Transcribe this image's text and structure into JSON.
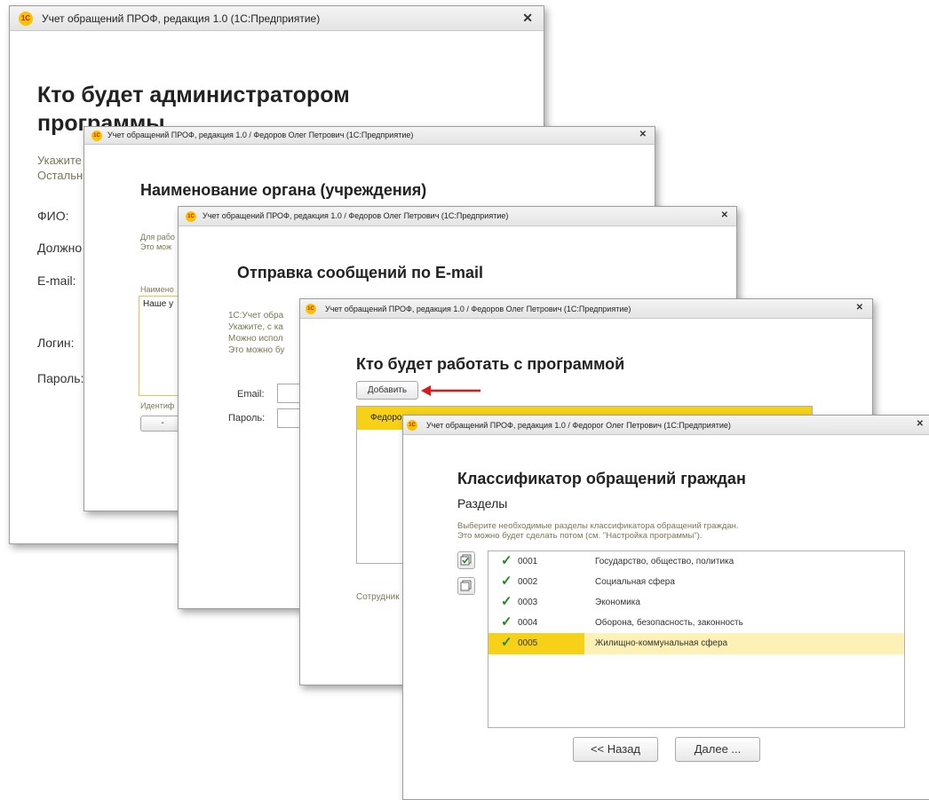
{
  "win1": {
    "title": "Учет обращений ПРОФ, редакция 1.0  (1С:Предприятие)",
    "heading_line1": "Кто будет администратором",
    "heading_line2": "программы",
    "desc1": "Укажите",
    "desc2": "Остальн",
    "fio_label": "ФИО:",
    "position_label": "Должно",
    "email_label": "E-mail:",
    "login_label": "Логин:",
    "password_label": "Пароль:"
  },
  "win2": {
    "title": "Учет обращений ПРОФ, редакция 1.0 / Федоров Олег Петрович  (1С:Предприятие)",
    "heading": "Наименование органа (учреждения)",
    "desc1": "Для рабо",
    "desc2": "Это мож",
    "name_label": "Наимено",
    "name_value": "Наше у",
    "ident_label": "Идентиф",
    "ident_value": "-"
  },
  "win3": {
    "title": "Учет обращений ПРОФ, редакция 1.0 / Федоров Олег Петрович  (1С:Предприятие)",
    "heading": "Отправка сообщений по E-mail",
    "desc1": "1С:Учет обра",
    "desc2": "Укажите, с ка",
    "desc3": "Можно испол",
    "desc4": "Это можно бу",
    "email_label": "Email:",
    "password_label": "Пароль:"
  },
  "win4": {
    "title": "Учет обращений ПРОФ, редакция 1.0 / Федоров Олег Петрович  (1С:Предприятие)",
    "heading": "Кто будет работать с программой",
    "add_button": "Добавить",
    "row1": "Федоро",
    "footer": "Сотрудник"
  },
  "win5": {
    "title": "Учет обращений ПРОФ, редакция 1.0 / Федорог Олег Петрович  (1С:Предприятие)",
    "heading": "Классификатор обращений граждан",
    "subheading": "Разделы",
    "desc1": "Выберите необходимые разделы классификатора обращений граждан.",
    "desc2": "Это можно будет сделать потом (см. \"Настройка программы\").",
    "items": [
      {
        "code": "0001",
        "name": "Государство, общество, политика",
        "checked": true
      },
      {
        "code": "0002",
        "name": "Социальная сфера",
        "checked": true
      },
      {
        "code": "0003",
        "name": "Экономика",
        "checked": true
      },
      {
        "code": "0004",
        "name": "Оборона, безопасность, законность",
        "checked": true
      },
      {
        "code": "0005",
        "name": "Жилищно-коммунальная сфера",
        "checked": true
      }
    ],
    "back_button": "<< Назад",
    "next_button": "Далее ..."
  },
  "logo_text": "1С",
  "colors": {
    "accent_yellow": "#f7d117",
    "selected_row": "#fdf1b6",
    "arrow": "#e01818",
    "label": "#7b7755"
  },
  "icons": {
    "close": "✕",
    "check": "✓"
  }
}
